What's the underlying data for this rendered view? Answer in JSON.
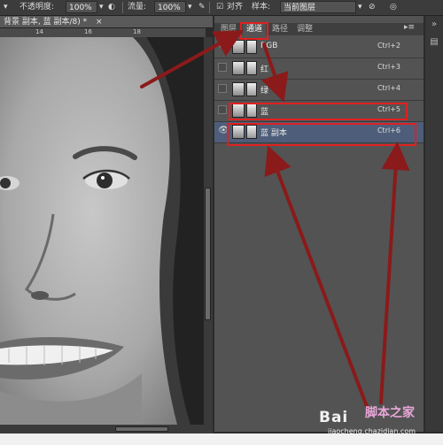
{
  "options_bar": {
    "opacity_label": "不透明度:",
    "opacity_value": "100%",
    "flow_label": "流量:",
    "flow_value": "100%",
    "align_label": "对齐",
    "sample_label": "样本:",
    "sample_value": "当前图层"
  },
  "document": {
    "tab_title": "背景 副本, 蓝 副本/8) *",
    "close_glyph": "×",
    "ruler_ticks": [
      "14",
      "16",
      "18"
    ]
  },
  "panel": {
    "tabs": [
      {
        "label": "图层",
        "active": false
      },
      {
        "label": "通道",
        "active": true
      },
      {
        "label": "路径",
        "active": false
      },
      {
        "label": "调整",
        "active": false
      }
    ],
    "menu_glyph": "▸≡",
    "channels": [
      {
        "name": "RGB",
        "shortcut": "Ctrl+2",
        "visible": true,
        "selected": false
      },
      {
        "name": "红",
        "shortcut": "Ctrl+3",
        "visible": false,
        "selected": false
      },
      {
        "name": "绿",
        "shortcut": "Ctrl+4",
        "visible": false,
        "selected": false
      },
      {
        "name": "蓝",
        "shortcut": "Ctrl+5",
        "visible": false,
        "selected": false
      },
      {
        "name": "蓝 副本",
        "shortcut": "Ctrl+6",
        "visible": true,
        "selected": true
      }
    ]
  },
  "watermark": {
    "brand": "Bai",
    "site_name": "脚本之家",
    "url": "jiaocheng.chazidian.com"
  },
  "colors": {
    "annotation_red": "#e02020",
    "arrow_dark_red": "#8b1a1a",
    "selection_blue": "#4e5e7a"
  }
}
